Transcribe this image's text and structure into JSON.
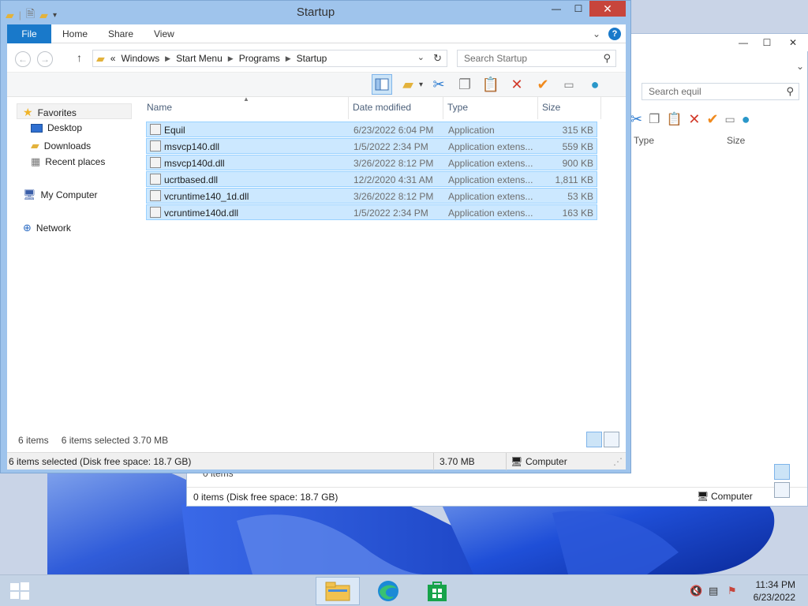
{
  "window": {
    "title": "Startup",
    "ribbon_tabs": [
      "File",
      "Home",
      "Share",
      "View"
    ],
    "breadcrumb": [
      "Windows",
      "Start Menu",
      "Programs",
      "Startup"
    ],
    "breadcrumb_prefix": "«",
    "search_placeholder": "Search Startup",
    "columns": [
      "Name",
      "Date modified",
      "Type",
      "Size"
    ],
    "files": [
      {
        "name": "Equil",
        "date": "6/23/2022 6:04 PM",
        "type": "Application",
        "size": "315 KB"
      },
      {
        "name": "msvcp140.dll",
        "date": "1/5/2022 2:34 PM",
        "type": "Application extens...",
        "size": "559 KB"
      },
      {
        "name": "msvcp140d.dll",
        "date": "3/26/2022 8:12 PM",
        "type": "Application extens...",
        "size": "900 KB"
      },
      {
        "name": "ucrtbased.dll",
        "date": "12/2/2020 4:31 AM",
        "type": "Application extens...",
        "size": "1,811 KB"
      },
      {
        "name": "vcruntime140_1d.dll",
        "date": "3/26/2022 8:12 PM",
        "type": "Application extens...",
        "size": "53 KB"
      },
      {
        "name": "vcruntime140d.dll",
        "date": "1/5/2022 2:34 PM",
        "type": "Application extens...",
        "size": "163 KB"
      }
    ],
    "nav": {
      "favorites": "Favorites",
      "desktop": "Desktop",
      "downloads": "Downloads",
      "recent": "Recent places",
      "computer": "My Computer",
      "network": "Network"
    },
    "info": {
      "count": "6 items",
      "selected": "6 items selected",
      "size": "3.70 MB"
    },
    "status": {
      "left": "6 items selected (Disk free space: 18.7 GB)",
      "size": "3.70 MB",
      "location": "Computer"
    }
  },
  "back_window": {
    "search_placeholder": "Search equil",
    "columns": [
      "Type",
      "Size"
    ],
    "items_count": "0 items",
    "status_left": "0 items (Disk free space: 18.7 GB)",
    "location": "Computer"
  },
  "taskbar": {
    "time": "11:34 PM",
    "date": "6/23/2022"
  },
  "colors": {
    "accent": "#1979ca",
    "selection_bg": "#cce8ff",
    "selection_border": "#99d1ff",
    "close_red": "#c7453c"
  }
}
